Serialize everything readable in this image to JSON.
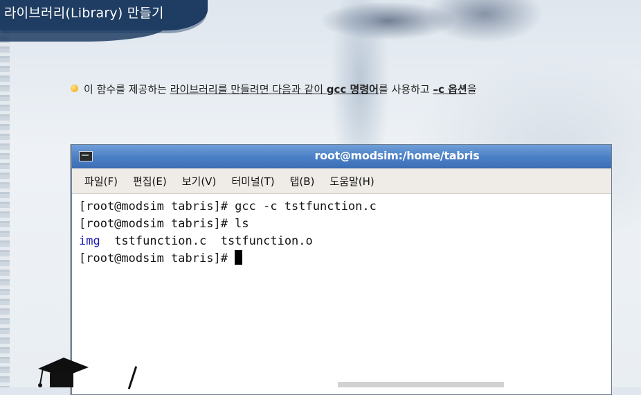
{
  "slide": {
    "title": "라이브러리(Library) 만들기",
    "bullet": {
      "t1": "이 함수를 제공하는 ",
      "t2": "라이브러리를 만들려면 다음과 같이 ",
      "t3": "gcc 명령어",
      "t4": "를 사용하고 ",
      "t5": "–c 옵션",
      "t6": "을"
    }
  },
  "window": {
    "title": "root@modsim:/home/tabris",
    "menu": [
      "파일(F)",
      "편집(E)",
      "보기(V)",
      "터미널(T)",
      "탭(B)",
      "도움말(H)"
    ]
  },
  "terminal": {
    "line1": "[root@modsim tabris]# gcc -c tstfunction.c",
    "line2": "[root@modsim tabris]# ls",
    "line3_dir": "img",
    "line3_rest": "  tstfunction.c  tstfunction.o",
    "line4": "[root@modsim tabris]# "
  },
  "icons": {
    "window": "terminal-window-icon",
    "bullet": "bullet-dot-icon",
    "cap": "graduation-cap-icon"
  },
  "colors": {
    "banner": "#1f3d63",
    "titlebar": "#4a7fc6",
    "directory": "#1a1ab3",
    "bullet": "#f0a400"
  }
}
